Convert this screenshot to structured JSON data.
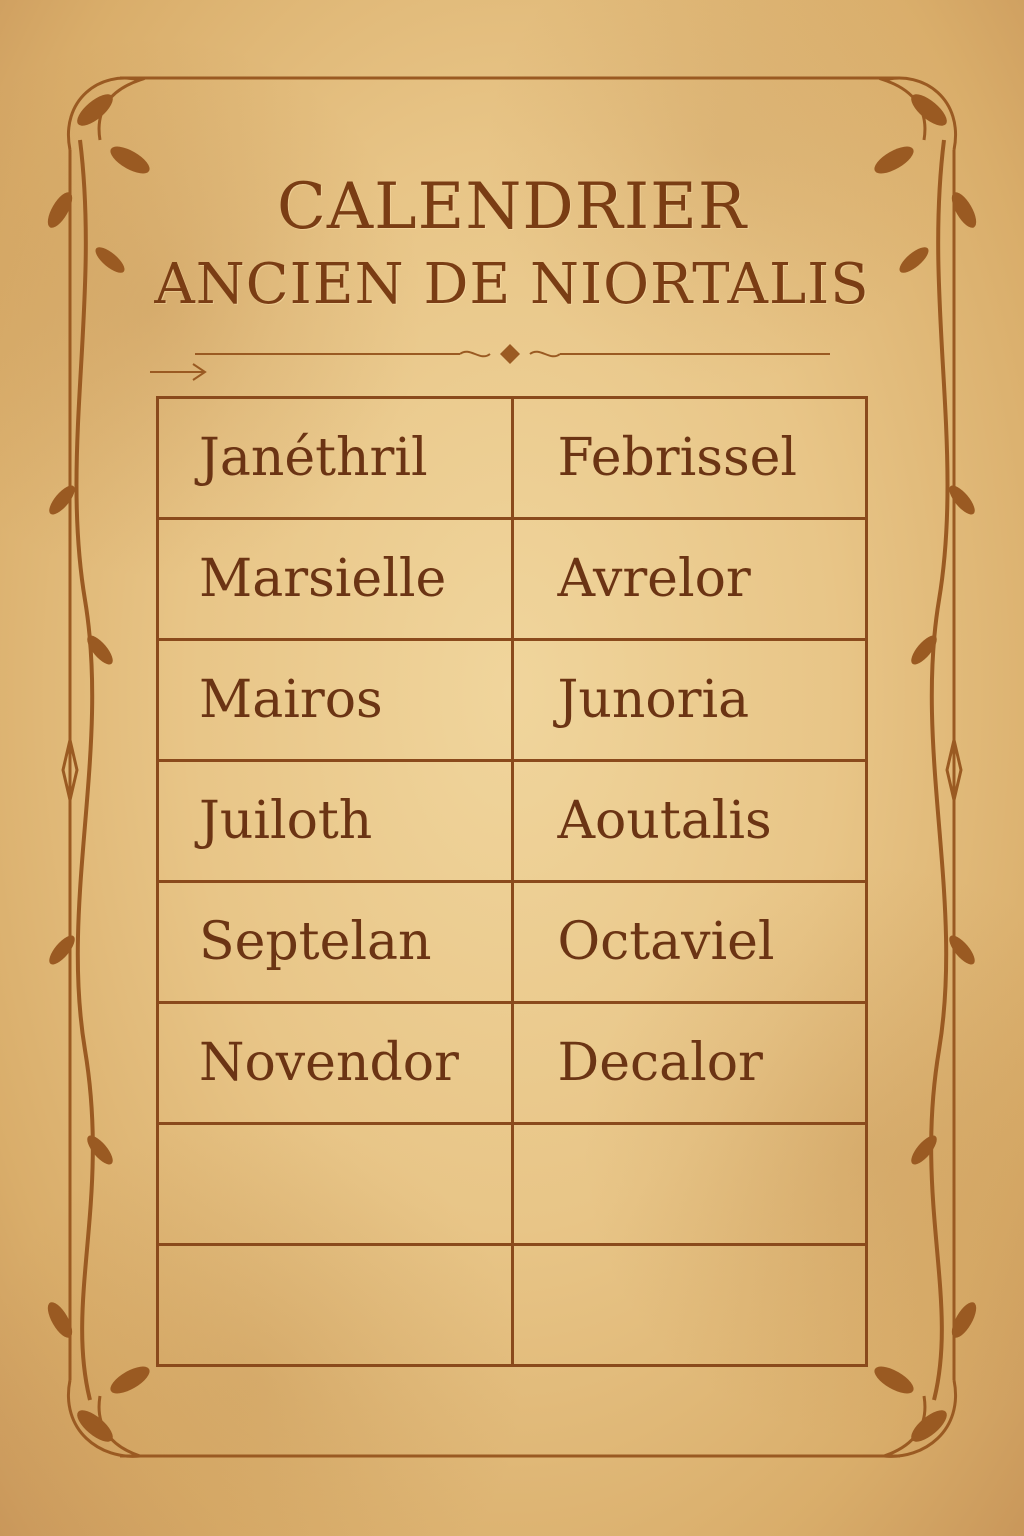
{
  "title": {
    "line1": "CALENDRIER",
    "line2": "ANCIEN DE NIORTALIS"
  },
  "months": [
    [
      "Janéthril",
      "Febrissel"
    ],
    [
      "Marsielle",
      "Avrelor"
    ],
    [
      "Mairos",
      "Junoria"
    ],
    [
      "Juiloth",
      "Aoutalis"
    ],
    [
      "Septelan",
      "Octaviel"
    ],
    [
      "Novendor",
      "Decalor"
    ],
    [
      "",
      ""
    ],
    [
      "",
      ""
    ]
  ],
  "colors": {
    "ink": "#7a3d14",
    "parchment": "#e8c587",
    "border": "#8a4a1c"
  }
}
